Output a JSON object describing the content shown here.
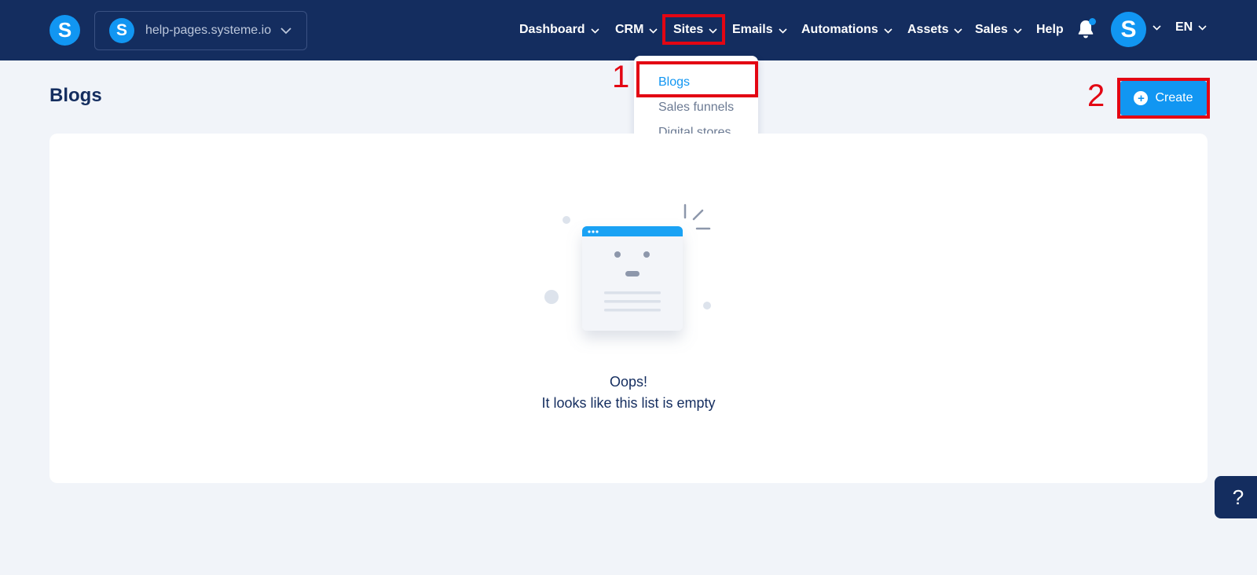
{
  "brand": {
    "logo_letter": "S",
    "workspace_letter": "S",
    "workspace_name": "help-pages.systeme.io"
  },
  "nav": {
    "items": [
      {
        "label": "Dashboard",
        "has_dropdown": true
      },
      {
        "label": "CRM",
        "has_dropdown": true
      },
      {
        "label": "Sites",
        "has_dropdown": true
      },
      {
        "label": "Emails",
        "has_dropdown": true
      },
      {
        "label": "Automations",
        "has_dropdown": true
      },
      {
        "label": "Assets",
        "has_dropdown": true
      },
      {
        "label": "Sales",
        "has_dropdown": true
      },
      {
        "label": "Help",
        "has_dropdown": false
      }
    ],
    "notification_icon": "bell-icon",
    "avatar_letter": "S",
    "language": "EN"
  },
  "sites_menu": {
    "items": [
      {
        "label": "Blogs",
        "active": true
      },
      {
        "label": "Sales funnels",
        "active": false
      },
      {
        "label": "Digital stores",
        "active": false
      }
    ]
  },
  "annotations": {
    "step_1": "1",
    "step_2": "2",
    "color": "#e30613"
  },
  "page": {
    "title": "Blogs",
    "create_label": "Create",
    "create_icon": "plus-circle-icon",
    "empty_title": "Oops!",
    "empty_subtitle": "It looks like this list is empty"
  },
  "help_fab": {
    "label": "?"
  },
  "colors": {
    "navbar": "#142d5f",
    "accent": "#1196f2",
    "background": "#f1f4f9"
  }
}
